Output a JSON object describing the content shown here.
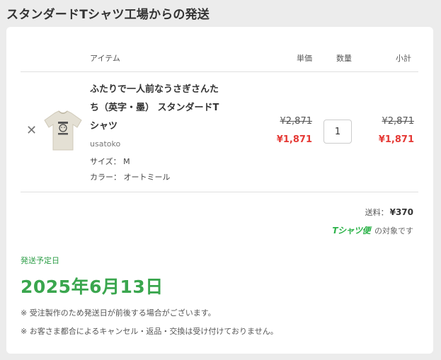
{
  "page": {
    "title": "スタンダードTシャツ工場からの発送"
  },
  "table": {
    "headers": {
      "item": "アイテム",
      "unit_price": "単価",
      "quantity": "数量",
      "subtotal": "小計"
    }
  },
  "cart_item": {
    "name": "ふたりで一人前なうさぎさんたち（英字・墨） スタンダードTシャツ",
    "creator": "usatoko",
    "size_label": "サイズ：",
    "size_value": "M",
    "color_label": "カラー：",
    "color_value": "オートミール",
    "unit_price_original": "¥2,871",
    "unit_price_sale": "¥1,871",
    "quantity": "1",
    "subtotal_original": "¥2,871",
    "subtotal_sale": "¥1,871",
    "remove_icon": "close-icon",
    "thumbnail_icon": "tshirt-icon"
  },
  "shipping": {
    "label": "送料：",
    "value": "¥370",
    "tbin_logo": "Tシャツ便",
    "tbin_text": "の対象です"
  },
  "delivery": {
    "label": "発送予定日",
    "date": "2025年6月13日",
    "note1": "※ 受注製作のため発送日が前後する場合がございます。",
    "note2": "※ お客さま都合によるキャンセル・返品・交換は受け付けておりません。"
  },
  "colors": {
    "background": "#ececec",
    "card": "#ffffff",
    "sale_price": "#e53935",
    "delivery_green": "#3aa64e",
    "tshirt": "#e4e0d4"
  }
}
